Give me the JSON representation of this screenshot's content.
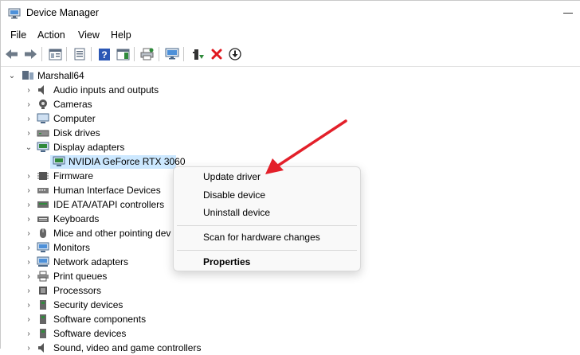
{
  "window": {
    "title": "Device Manager"
  },
  "menu": [
    "File",
    "Action",
    "View",
    "Help"
  ],
  "toolbar": {
    "buttons": [
      "back-icon",
      "forward-icon",
      "properties-view-icon",
      "show-hide-icon",
      "help-icon",
      "action-pane-icon",
      "print-icon",
      "scan-monitor-icon",
      "enable-device-icon",
      "uninstall-x-icon",
      "update-driver-down-icon"
    ]
  },
  "tree": {
    "root": "Marshall64",
    "categories": [
      "Audio inputs and outputs",
      "Cameras",
      "Computer",
      "Disk drives",
      "Display adapters",
      "NVIDIA GeForce RTX 3060",
      "Firmware",
      "Human Interface Devices",
      "IDE ATA/ATAPI controllers",
      "Keyboards",
      "Mice and other pointing dev",
      "Monitors",
      "Network adapters",
      "Print queues",
      "Processors",
      "Security devices",
      "Software components",
      "Software devices",
      "Sound, video and game controllers"
    ]
  },
  "context_menu": {
    "update_driver": "Update driver",
    "disable_device": "Disable device",
    "uninstall_device": "Uninstall device",
    "scan_changes": "Scan for hardware changes",
    "properties": "Properties"
  },
  "colors": {
    "selection": "#cce8ff",
    "arrow": "#e3202a",
    "help_icon": "#2b57b5",
    "x_icon": "#e0191f",
    "green": "#2f8a3b"
  }
}
